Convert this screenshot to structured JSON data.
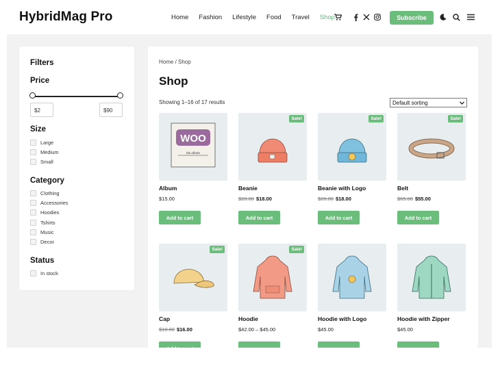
{
  "site": {
    "logo": "HybridMag Pro"
  },
  "nav": {
    "items": [
      "Home",
      "Fashion",
      "Lifestyle",
      "Food",
      "Travel",
      "Shop"
    ],
    "active": "Shop"
  },
  "header": {
    "subscribe_label": "Subscribe"
  },
  "filters": {
    "title": "Filters",
    "price": {
      "title": "Price",
      "min": "$2",
      "max": "$90"
    },
    "size": {
      "title": "Size",
      "options": [
        "Large",
        "Medium",
        "Small"
      ]
    },
    "category": {
      "title": "Category",
      "options": [
        "Clothing",
        "Accessories",
        "Hoodies",
        "Tshirts",
        "Music",
        "Decor"
      ]
    },
    "status": {
      "title": "Status",
      "options": [
        "In stock"
      ]
    }
  },
  "shop": {
    "breadcrumb": {
      "home": "Home",
      "separator": " / ",
      "current": "Shop"
    },
    "title": "Shop",
    "result_count": "Showing 1–16 of 17 results",
    "sorting": "Default sorting",
    "sale_badge": "Sale!",
    "add_to_cart": "Add to cart",
    "products": [
      {
        "name": "Album",
        "price": "$15.00",
        "old_price": "",
        "sale": false,
        "icon": "album-icon"
      },
      {
        "name": "Beanie",
        "price": "$18.00",
        "old_price": "$20.00",
        "sale": true,
        "icon": "beanie-icon"
      },
      {
        "name": "Beanie with Logo",
        "price": "$18.00",
        "old_price": "$20.00",
        "sale": true,
        "icon": "beanie-logo-icon"
      },
      {
        "name": "Belt",
        "price": "$55.00",
        "old_price": "$65.00",
        "sale": true,
        "icon": "belt-icon"
      },
      {
        "name": "Cap",
        "price": "$16.00",
        "old_price": "$18.00",
        "sale": true,
        "icon": "cap-icon"
      },
      {
        "name": "Hoodie",
        "price": "$42.00 – $45.00",
        "old_price": "",
        "sale": true,
        "icon": "hoodie-icon"
      },
      {
        "name": "Hoodie with Logo",
        "price": "$45.00",
        "old_price": "",
        "sale": false,
        "icon": "hoodie-logo-icon"
      },
      {
        "name": "Hoodie with Zipper",
        "price": "$45.00",
        "old_price": "",
        "sale": false,
        "icon": "hoodie-zipper-icon"
      }
    ]
  },
  "colors": {
    "accent": "#6bbd7c",
    "backdrop": "#f2f2f2",
    "thumb_bg": "#e8eeef"
  }
}
